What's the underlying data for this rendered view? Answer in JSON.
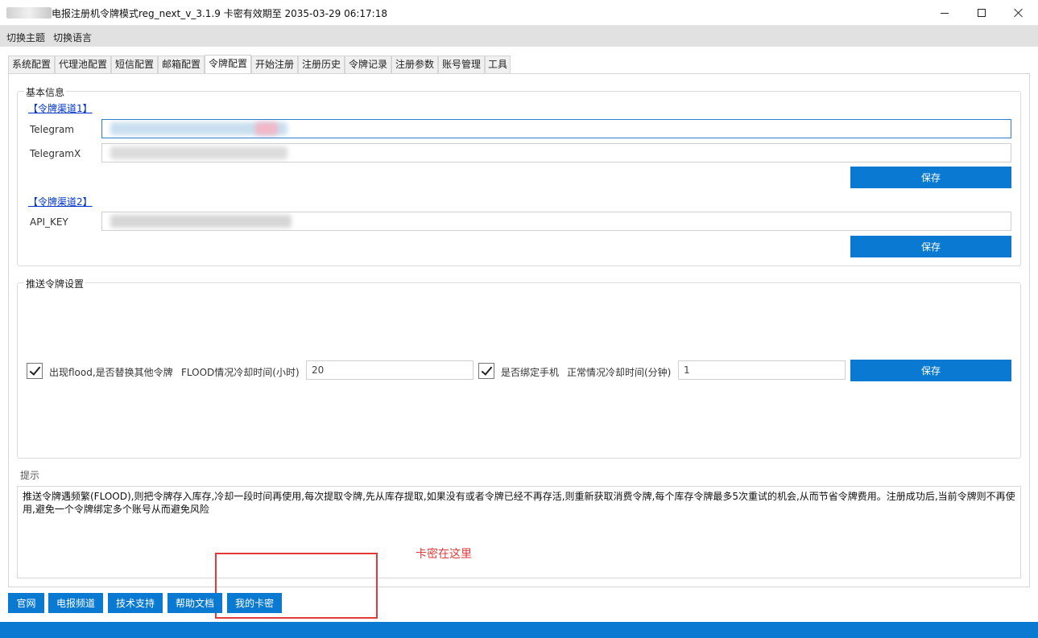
{
  "window": {
    "title": "电报注册机令牌模式reg_next_v_3.1.9 卡密有效期至 2035-03-29 06:17:18"
  },
  "menu": {
    "switch_theme": "切换主题",
    "switch_language": "切换语言"
  },
  "tabs": [
    {
      "label": "系统配置"
    },
    {
      "label": "代理池配置"
    },
    {
      "label": "短信配置"
    },
    {
      "label": "邮箱配置"
    },
    {
      "label": "令牌配置",
      "active": true
    },
    {
      "label": "开始注册"
    },
    {
      "label": "注册历史"
    },
    {
      "label": "令牌记录"
    },
    {
      "label": "注册参数"
    },
    {
      "label": "账号管理"
    },
    {
      "label": "工具"
    }
  ],
  "basic_info": {
    "title": "基本信息",
    "channel1_link": "【令牌渠道1】",
    "telegram_label": "Telegram",
    "telegramx_label": "TelegramX",
    "save_label": "保存",
    "channel2_link": "【令牌渠道2】",
    "api_key_label": "API_KEY"
  },
  "push_settings": {
    "title": "推送令牌设置",
    "flood_replace_label": "出现flood,是否替换其他令牌",
    "flood_cooldown_label": "FLOOD情况冷却时间(小时)",
    "flood_cooldown_value": "20",
    "bind_phone_label": "是否绑定手机",
    "normal_cooldown_label": "正常情况冷却时间(分钟)",
    "normal_cooldown_value": "1",
    "save_label": "保存"
  },
  "tips": {
    "title": "提示",
    "text": "推送令牌遇频繁(FLOOD),则把令牌存入库存,冷却一段时间再使用,每次提取令牌,先从库存提取,如果没有或者令牌已经不再存活,则重新获取消费令牌,每个库存令牌最多5次重试的机会,从而节省令牌费用。注册成功后,当前令牌则不再使用,避免一个令牌绑定多个账号从而避免风险"
  },
  "annotation": {
    "text": "卡密在这里"
  },
  "bottom_buttons": {
    "official_site": "官网",
    "telegram_channel": "电报频道",
    "tech_support": "技术支持",
    "help_docs": "帮助文档",
    "my_card_key": "我的卡密"
  },
  "colors": {
    "accent": "#0a79d1",
    "annotation": "#e23a3a",
    "link": "#0033cc"
  }
}
